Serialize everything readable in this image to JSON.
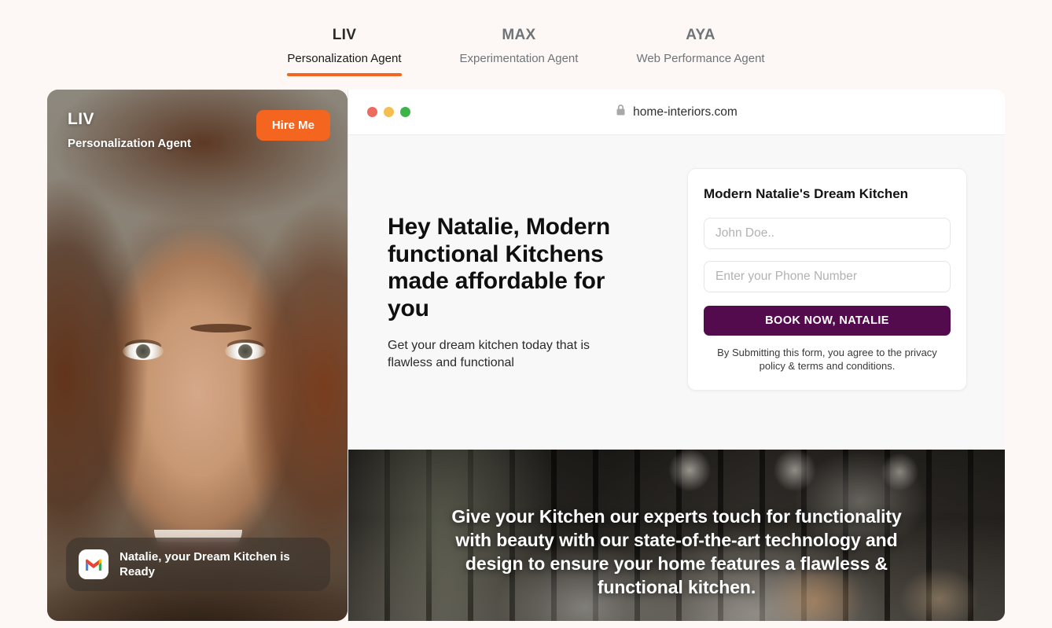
{
  "tabs": [
    {
      "code": "LIV",
      "name": "Personalization Agent",
      "active": true
    },
    {
      "code": "MAX",
      "name": "Experimentation Agent",
      "active": false
    },
    {
      "code": "AYA",
      "name": "Web Performance Agent",
      "active": false
    }
  ],
  "agent_card": {
    "code": "LIV",
    "role": "Personalization Agent",
    "hire_label": "Hire Me",
    "toast": {
      "icon": "gmail-icon",
      "message": "Natalie, your Dream Kitchen is Ready"
    }
  },
  "browser": {
    "lock_icon": "lock-icon",
    "url": "home-interiors.com",
    "traffic_lights": [
      "close-red",
      "minimize-yellow",
      "maximize-green"
    ]
  },
  "hero": {
    "headline": "Hey Natalie, Modern functional Kitchens made affordable for you",
    "subtext": "Get your dream kitchen today that is flawless and functional"
  },
  "form": {
    "title": "Modern Natalie's Dream Kitchen",
    "name_value": "",
    "name_placeholder": "John Doe..",
    "phone_value": "",
    "phone_placeholder": "Enter your Phone Number",
    "submit_label": "BOOK NOW, NATALIE",
    "disclaimer": "By Submitting this form, you agree to the privacy policy & terms and conditions."
  },
  "banner": {
    "text": "Give your Kitchen our experts touch for functionality with beauty with our state-of-the-art technology and design to ensure your home features a flawless & functional kitchen."
  },
  "colors": {
    "page_background": "#fdf8f5",
    "accent_orange": "#f4651f",
    "button_purple": "#530b4d",
    "tab_inactive": "#6e7478",
    "traffic_red": "#ec6a5e",
    "traffic_yellow": "#f4bf4f",
    "traffic_green": "#3cb44a"
  }
}
